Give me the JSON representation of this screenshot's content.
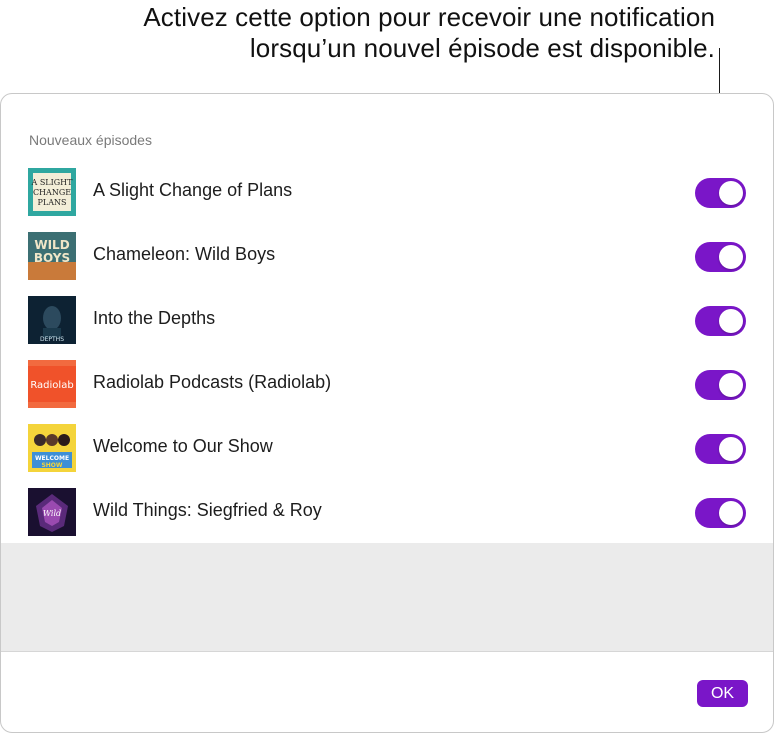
{
  "callout": {
    "line1": "Activez cette option pour recevoir une notification",
    "line2": "lorsqu’un nouvel épisode est disponible."
  },
  "dialog": {
    "section_label": "Nouveaux épisodes",
    "ok_label": "OK",
    "accent_color": "#7a16c8"
  },
  "podcasts": [
    {
      "title": "A Slight Change of Plans",
      "art_text": "A SLIGHT CHANGE of PLANS",
      "notify_on": true
    },
    {
      "title": "Chameleon: Wild Boys",
      "art_text": "WILD BOYS",
      "notify_on": true
    },
    {
      "title": "Into the Depths",
      "art_text": "DEPTHS",
      "notify_on": true
    },
    {
      "title": "Radiolab Podcasts (Radiolab)",
      "art_text": "Radiolab",
      "notify_on": true
    },
    {
      "title": "Welcome to Our Show",
      "art_text": "WELCOME TO OUR SHOW",
      "notify_on": true
    },
    {
      "title": "Wild Things: Siegfried & Roy",
      "art_text": "Wild Things",
      "notify_on": true
    }
  ]
}
